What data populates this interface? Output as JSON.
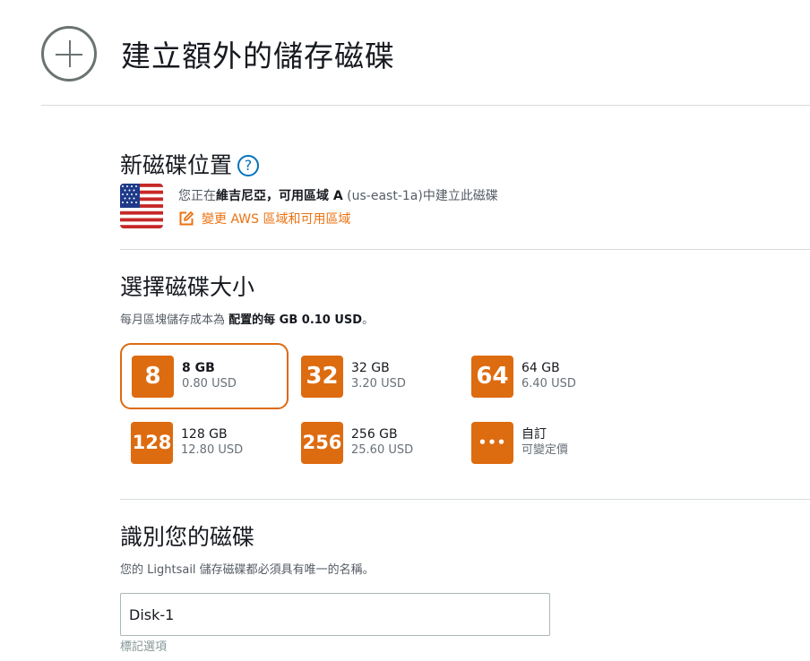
{
  "page": {
    "title": "建立額外的儲存磁碟"
  },
  "location": {
    "heading": "新磁碟位置",
    "help_symbol": "?",
    "text_prefix": "您正在",
    "region": "維吉尼亞，可用區域 A",
    "text_suffix": " (us-east-1a)中建立此磁碟",
    "change_label": "變更 AWS 區域和可用區域",
    "flag": "us-flag"
  },
  "size": {
    "heading": "選擇磁碟大小",
    "cost_prefix": "每月區塊儲存成本為 ",
    "cost_bold": "配置的每 GB 0.10 USD",
    "cost_suffix": "。",
    "options": [
      {
        "badge": "8",
        "gb": "8 GB",
        "price": "0.80 USD",
        "selected": true
      },
      {
        "badge": "32",
        "gb": "32 GB",
        "price": "3.20 USD",
        "selected": false
      },
      {
        "badge": "64",
        "gb": "64 GB",
        "price": "6.40 USD",
        "selected": false
      },
      {
        "badge": "128",
        "gb": "128 GB",
        "price": "12.80 USD",
        "selected": false
      },
      {
        "badge": "256",
        "gb": "256 GB",
        "price": "25.60 USD",
        "selected": false
      },
      {
        "badge": "•••",
        "gb": "自訂",
        "price": "可變定價",
        "selected": false
      }
    ]
  },
  "identify": {
    "heading": "識別您的磁碟",
    "description": "您的 Lightsail 儲存磁碟都必須具有唯一的名稱。",
    "name_value": "Disk-1",
    "tag_label": "標記選項"
  },
  "colors": {
    "accent": "#dd6b10",
    "link": "#ec7211",
    "help": "#0073bb"
  }
}
